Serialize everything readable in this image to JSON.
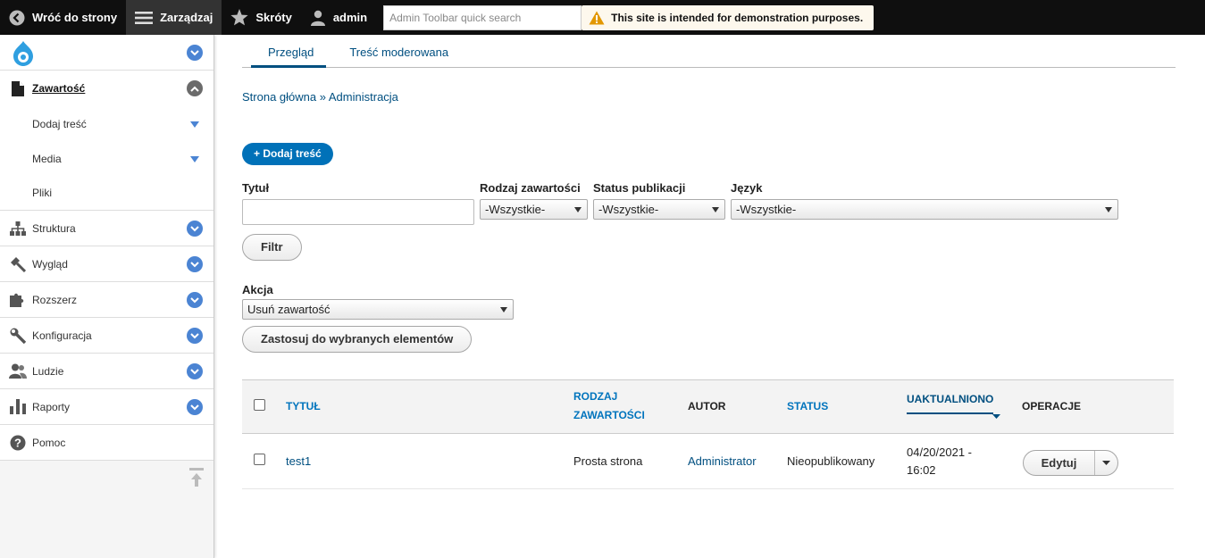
{
  "toolbar": {
    "back_label": "Wróć do strony",
    "manage_label": "Zarządzaj",
    "shortcuts_label": "Skróty",
    "user_label": "admin",
    "search_placeholder": "Admin Toolbar quick search",
    "warning_text": "This site is intended for demonstration purposes."
  },
  "sidebar": {
    "content": {
      "label": "Zawartość",
      "children": [
        {
          "label": "Dodaj treść"
        },
        {
          "label": "Media"
        },
        {
          "label": "Pliki"
        }
      ]
    },
    "items": [
      {
        "label": "Struktura",
        "icon": "sitemap-icon"
      },
      {
        "label": "Wygląd",
        "icon": "paintbrush-icon"
      },
      {
        "label": "Rozszerz",
        "icon": "puzzle-icon"
      },
      {
        "label": "Konfiguracja",
        "icon": "wrench-icon"
      },
      {
        "label": "Ludzie",
        "icon": "people-icon"
      },
      {
        "label": "Raporty",
        "icon": "bar-chart-icon"
      },
      {
        "label": "Pomoc",
        "icon": "help-icon"
      }
    ]
  },
  "tabs": [
    {
      "label": "Przegląd",
      "active": true
    },
    {
      "label": "Treść moderowana",
      "active": false
    }
  ],
  "breadcrumb": {
    "home": "Strona główna",
    "separator": "»",
    "admin": "Administracja"
  },
  "add_content_label": "+ Dodaj treść",
  "filters": {
    "title_label": "Tytuł",
    "title_value": "",
    "type_label": "Rodzaj zawartości",
    "type_value": "-Wszystkie-",
    "status_label": "Status publikacji",
    "status_value": "-Wszystkie-",
    "language_label": "Język",
    "language_value": "-Wszystkie-",
    "filter_button": "Filtr"
  },
  "action": {
    "label": "Akcja",
    "value": "Usuń zawartość",
    "apply_button": "Zastosuj do wybranych elementów"
  },
  "table": {
    "headers": {
      "title": "TYTUŁ",
      "type_line1": "RODZAJ",
      "type_line2": "ZAWARTOŚCI",
      "author": "AUTOR",
      "status": "STATUS",
      "updated": "UAKTUALNIONO",
      "operations": "OPERACJE"
    },
    "rows": [
      {
        "title": "test1",
        "type": "Prosta strona",
        "author": "Administrator",
        "status": "Nieopublikowany",
        "updated_line1": "04/20/2021 -",
        "updated_line2": "16:02",
        "edit_label": "Edytuj"
      }
    ]
  },
  "colors": {
    "link": "#004f80",
    "header_link": "#0074bd",
    "primary_button": "#0071b8",
    "toggle": "#4b84d3",
    "toolbar_bg": "#0f0f0f"
  }
}
